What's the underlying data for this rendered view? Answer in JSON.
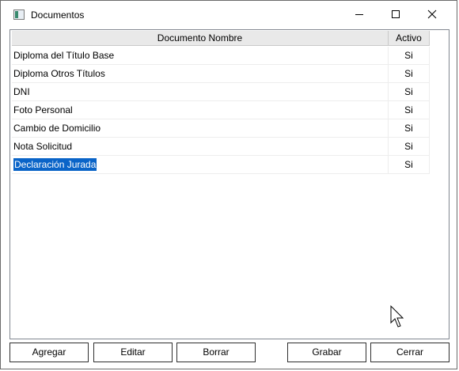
{
  "window": {
    "title": "Documentos"
  },
  "grid": {
    "columns": [
      "Documento Nombre",
      "Activo"
    ],
    "rows": [
      {
        "name": "Diploma del Título Base",
        "activo": "Si"
      },
      {
        "name": "Diploma Otros Títulos",
        "activo": "Si"
      },
      {
        "name": "DNI",
        "activo": "Si"
      },
      {
        "name": "Foto Personal",
        "activo": "Si"
      },
      {
        "name": "Cambio de Domicilio",
        "activo": "Si"
      },
      {
        "name": "Nota Solicitud",
        "activo": "Si"
      },
      {
        "name": "Declaración Jurada",
        "activo": "Si"
      }
    ],
    "selected_row": "Declaración Jurada",
    "selection_color": "#0a64c8"
  },
  "buttons": {
    "agregar": "Agregar",
    "editar": "Editar",
    "borrar": "Borrar",
    "grabar": "Grabar",
    "cerrar": "Cerrar"
  },
  "icons": {
    "app": "window-app-icon",
    "minimize": "minimize-icon",
    "maximize": "maximize-icon",
    "close": "close-icon",
    "cursor": "mouse-pointer-icon"
  }
}
